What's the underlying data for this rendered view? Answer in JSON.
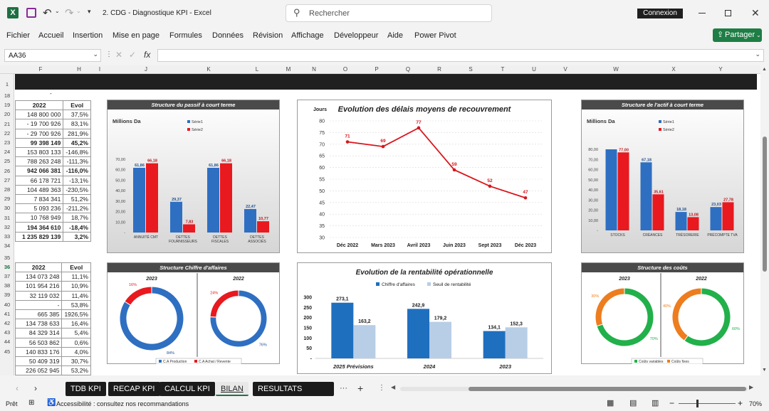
{
  "app": {
    "title": "2. CDG - Diagnostique KPI  -  Excel",
    "search_placeholder": "Rechercher",
    "signin": "Connexion",
    "share": "Partager",
    "excel_icon": "X"
  },
  "menu": [
    "Fichier",
    "Accueil",
    "Insertion",
    "Mise en page",
    "Formules",
    "Données",
    "Révision",
    "Affichage",
    "Développeur",
    "Aide",
    "Power Pivot"
  ],
  "formula": {
    "namebox": "AA36",
    "fx": "fx",
    "value": ""
  },
  "columns": [
    "F",
    "H",
    "I",
    "J",
    "K",
    "L",
    "M",
    "N",
    "O",
    "P",
    "Q",
    "R",
    "S",
    "T",
    "U",
    "V",
    "W",
    "X",
    "Y"
  ],
  "rows": [
    "1",
    "18",
    "19",
    "20",
    "21",
    "22",
    "23",
    "24",
    "25",
    "26",
    "27",
    "28",
    "29",
    "30",
    "31",
    "32",
    "33",
    "34",
    "35",
    "36",
    "37",
    "38",
    "39",
    "40",
    "41",
    "42",
    "43",
    "44",
    "45"
  ],
  "small_dash": "-",
  "table1": {
    "head": [
      "2022",
      "Evol"
    ],
    "rows": [
      [
        "148 800 000",
        "37,5%"
      ],
      [
        "- 19 700 926",
        "83,1%"
      ],
      [
        "- 29 700 926",
        "281,9%"
      ],
      [
        "99 398 149",
        "45,2%"
      ],
      [
        "153 803 133",
        "-146,8%"
      ],
      [
        "788 263 248",
        "-111,3%"
      ],
      [
        "942 066 381",
        "-116,0%"
      ],
      [
        "66 178 721",
        "-13,1%"
      ],
      [
        "104 489 363",
        "-230,5%"
      ],
      [
        "7 834 341",
        "51,2%"
      ],
      [
        "5 093 236",
        "-211,2%"
      ],
      [
        "10 768 949",
        "18,7%"
      ],
      [
        "194 364 610",
        "-18,4%"
      ],
      [
        "1 235 829 139",
        "3,2%"
      ]
    ],
    "bold": [
      3,
      6,
      12,
      13
    ]
  },
  "table2": {
    "head": [
      "2022",
      "Evol"
    ],
    "rows": [
      [
        "134 073 248",
        "11,1%"
      ],
      [
        "101 954 216",
        "10,9%"
      ],
      [
        "32 119 032",
        "11,4%"
      ],
      [
        "-",
        "53,8%"
      ],
      [
        "665 385",
        "1926,5%"
      ],
      [
        "134 738 633",
        "16,4%"
      ],
      [
        "84 329 314",
        "5,4%"
      ],
      [
        "56 503 862",
        "0,6%"
      ],
      [
        "140 833 176",
        "4,0%"
      ],
      [
        "50 409 319",
        "30,7%"
      ],
      [
        "226 052 945",
        "53,2%"
      ]
    ]
  },
  "chart_data": [
    {
      "type": "bar",
      "title": "Structure du passif à court terme",
      "unit_label": "Millions Da",
      "categories": [
        "ANNUITÉ CMT",
        "DETTES FOURNISSEURS",
        "DETTES FISCALES",
        "DETTES ASSOCIÉS"
      ],
      "series": [
        {
          "name": "Série1",
          "color": "#2e6fc2",
          "values": [
            61.86,
            29.37,
            61.86,
            22.47
          ]
        },
        {
          "name": "Série2",
          "color": "#e8191f",
          "values": [
            66.18,
            7.83,
            66.18,
            10.77
          ]
        }
      ],
      "ylim": [
        0,
        70
      ],
      "yticks": [
        "-",
        "10,00",
        "20,00",
        "30,00",
        "40,00",
        "50,00",
        "60,00",
        "70,00"
      ],
      "labels": [
        [
          "61,86",
          "29,37",
          "61,86",
          "22,47"
        ],
        [
          "66,18",
          "7,83",
          "66,18",
          "10,77"
        ]
      ],
      "legend": "top-center"
    },
    {
      "type": "line",
      "title": "Evolution des délais moyens de recouvrement",
      "ylabel": "Jours",
      "categories": [
        "Déc 2022",
        "Mars 2023",
        "Avril 2023",
        "Juin 2023",
        "Sept 2023",
        "Déc 2023"
      ],
      "values": [
        71,
        69,
        77,
        59,
        52,
        47
      ],
      "ylim": [
        30,
        80
      ],
      "yticks": [
        "30",
        "35",
        "40",
        "45",
        "50",
        "55",
        "60",
        "65",
        "70",
        "75",
        "80"
      ],
      "color": "#d9151b",
      "grid": true
    },
    {
      "type": "bar",
      "title": "Structure de l'actif à court terme",
      "unit_label": "Millions Da",
      "categories": [
        "STOCKS",
        "CRÉANCES",
        "TRÉSORERIE",
        "PRÉCOMPTE TVA"
      ],
      "series": [
        {
          "name": "Série1",
          "color": "#2e6fc2",
          "values": [
            80.0,
            67.18,
            18.18,
            23.03
          ]
        },
        {
          "name": "Série2",
          "color": "#e8191f",
          "values": [
            77.0,
            35.61,
            13.08,
            27.78
          ]
        }
      ],
      "ylim": [
        0,
        80
      ],
      "yticks": [
        "-",
        "10,00",
        "20,00",
        "30,00",
        "40,00",
        "50,00",
        "60,00",
        "70,00",
        "80,00"
      ],
      "labels": [
        [
          "",
          "67,18",
          "18,18",
          "23,03"
        ],
        [
          "77,00",
          "35,61",
          "13,08",
          "27,78"
        ]
      ],
      "legend": "top-center"
    },
    {
      "type": "pie",
      "title": "Structure Chiffre d'affaires",
      "variant": "donut",
      "panels": [
        {
          "year": "2023",
          "slices": [
            {
              "name": "C.A Production",
              "value": 84,
              "color": "#2e6fc2"
            },
            {
              "name": "C.A Achat / Revente",
              "value": 16,
              "color": "#e8191f"
            }
          ],
          "labels": [
            "84%",
            "16%"
          ]
        },
        {
          "year": "2022",
          "slices": [
            {
              "name": "C.A Production",
              "value": 76,
              "color": "#2e6fc2"
            },
            {
              "name": "C.A Achat / Revente",
              "value": 24,
              "color": "#e8191f"
            }
          ],
          "labels": [
            "76%",
            "24%"
          ]
        }
      ],
      "legend": [
        "C.A Production",
        "C.A Achat / Revente"
      ]
    },
    {
      "type": "bar",
      "title": "Evolution de la rentabilité opérationnelle",
      "categories": [
        "2025 Prévisions",
        "2024",
        "2023"
      ],
      "series": [
        {
          "name": "Chiffre d'affaires",
          "color": "#1f6fbf",
          "values": [
            273.1,
            242.9,
            134.1
          ]
        },
        {
          "name": "Seuil de rentabilité",
          "color": "#b8cde6",
          "values": [
            163.2,
            179.2,
            152.3
          ]
        }
      ],
      "labels": [
        [
          "273,1",
          "242,9",
          "134,1"
        ],
        [
          "163,2",
          "179,2",
          "152,3"
        ]
      ],
      "ylim": [
        0,
        300
      ],
      "yticks": [
        "-",
        "50",
        "100",
        "150",
        "200",
        "250",
        "300"
      ],
      "legend": "top"
    },
    {
      "type": "pie",
      "title": "Structure des coûts",
      "variant": "donut",
      "panels": [
        {
          "year": "2023",
          "slices": [
            {
              "name": "Coûts variables",
              "value": 70,
              "color": "#22b04b"
            },
            {
              "name": "Coûts fixes",
              "value": 30,
              "color": "#ed7d1e"
            }
          ],
          "labels": [
            "70%",
            "30%"
          ]
        },
        {
          "year": "2022",
          "slices": [
            {
              "name": "Coûts variables",
              "value": 60,
              "color": "#22b04b"
            },
            {
              "name": "Coûts fixes",
              "value": 40,
              "color": "#ed7d1e"
            }
          ],
          "labels": [
            "60%",
            "40%"
          ]
        }
      ],
      "legend": [
        "Coûts variables",
        "Coûts fixes"
      ]
    }
  ],
  "sheets": [
    "TDB KPI",
    "RECAP KPI",
    "CALCUL KPI",
    "BILAN",
    "RESULTATS ANALYTIC"
  ],
  "active_sheet": "BILAN",
  "status": {
    "ready": "Prêt",
    "accessibility": "Accessibilité : consultez nos recommandations",
    "zoom": "70%"
  }
}
